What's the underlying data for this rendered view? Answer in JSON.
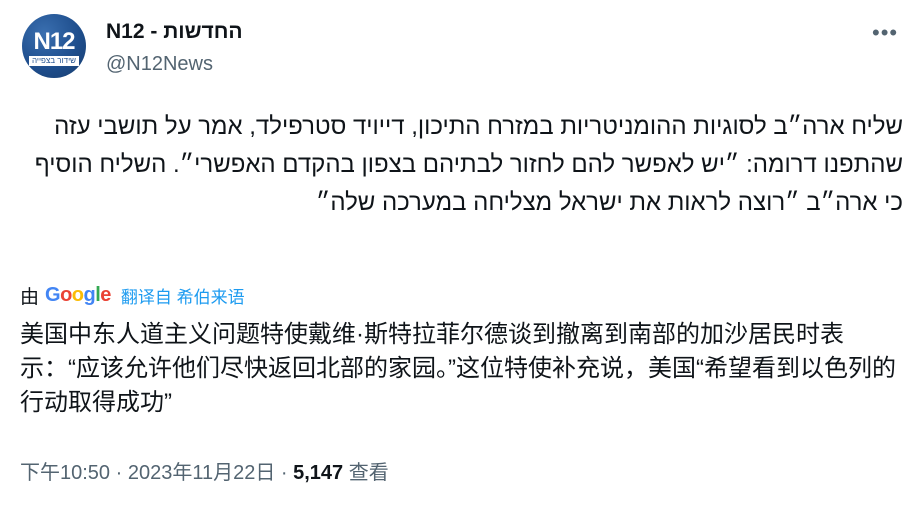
{
  "author": {
    "avatar_text": "N12",
    "avatar_subtext": "שידור בצפייה",
    "display_name": "N12 - החדשות",
    "handle": "@N12News"
  },
  "more_icon": "more-horizontal-icon",
  "tweet": {
    "text": "שליח ארה״ב לסוגיות ההומניטריות במזרח התיכון, דייויד סטרפילד, אמר על תושבי עזה שהתפנו דרומה: ״יש לאפשר להם לחזור לבתיהם בצפון בהקדם האפשרי״. השליח הוסיף כי ארה״ב ״רוצה לראות את ישראל מצליחה במערכה שלה״"
  },
  "translation": {
    "by_label": "由",
    "provider": "Google",
    "link_label": "翻译自 希伯来语",
    "text": "美国中东人道主义问题特使戴维·斯特拉菲尔德谈到撤离到南部的加沙居民时表示：“应该允许他们尽快返回北部的家园。”这位特使补充说，美国“希望看到以色列的行动取得成功”"
  },
  "meta": {
    "time": "下午10:50",
    "sep1": " · ",
    "date": "2023年11月22日",
    "sep2": " · ",
    "views_count": "5,147",
    "views_label": " 查看"
  },
  "colors": {
    "link": "#1d9bf0",
    "secondary": "#536471",
    "text": "#0f1419"
  }
}
